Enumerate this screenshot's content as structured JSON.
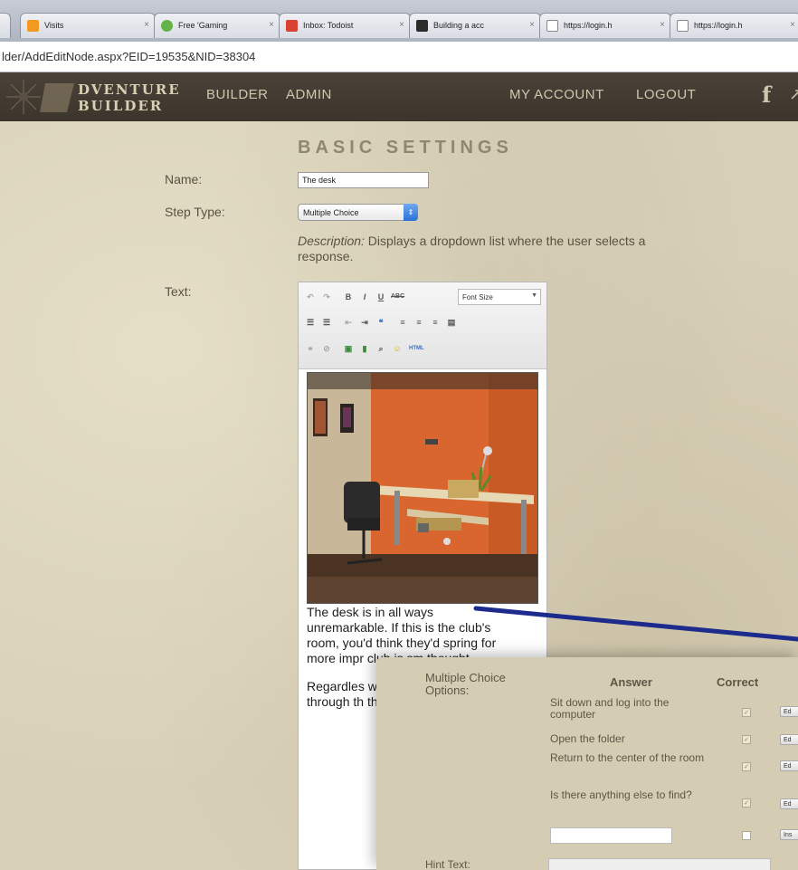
{
  "browser": {
    "tabs": [
      {
        "title": "",
        "icon_color": "#9aa0aa"
      },
      {
        "title": "Visits",
        "icon_color": "#f29a1f"
      },
      {
        "title": "Free 'Gaming",
        "icon_color": "#66b24a"
      },
      {
        "title": "Inbox: Todoist",
        "icon_color": "#d94133"
      },
      {
        "title": "Building a acc",
        "icon_color": "#2b2b2b"
      },
      {
        "title": "https://login.h",
        "icon_color": "#ffffff"
      },
      {
        "title": "https://login.h",
        "icon_color": "#ffffff"
      }
    ],
    "close_glyph": "×",
    "url": "lder/AddEditNode.aspx?EID=19535&NID=38304"
  },
  "header": {
    "logo_line1": "DVENTURE",
    "logo_line2": "BUILDER",
    "nav": [
      "BUILDER",
      "ADMIN",
      "MY ACCOUNT",
      "LOGOUT"
    ],
    "social_facebook": "f"
  },
  "form": {
    "section_title": "BASIC SETTINGS",
    "name_label": "Name:",
    "name_value": "The desk",
    "step_type_label": "Step Type:",
    "step_type_value": "Multiple Choice",
    "description_prefix": "Description:",
    "description_text": " Displays a dropdown list where the user selects a response.",
    "text_label": "Text:"
  },
  "editor": {
    "font_size_label": "Font Size",
    "toolbar_icons": [
      "undo-icon",
      "redo-icon",
      "bold-icon",
      "italic-icon",
      "underline-icon",
      "strikethrough-icon",
      "bullet-list-icon",
      "numbered-list-icon",
      "outdent-icon",
      "indent-icon",
      "blockquote-icon",
      "align-left-icon",
      "align-center-icon",
      "align-right-icon",
      "justify-icon",
      "link-icon",
      "unlink-icon",
      "image-icon",
      "media-icon",
      "find-icon",
      "emoticon-icon",
      "html-icon"
    ],
    "story_p1": "The desk is in all ways unremarkable. If this is the club's room, you'd think they'd spring for more impr club is sm thought.",
    "story_p2": "Regardles waiting for anyone we through th the desk."
  },
  "choices_panel": {
    "label": "Multiple Choice Options:",
    "col_answer": "Answer",
    "col_correct": "Correct",
    "answers": [
      {
        "text": "Sit down and log into the computer",
        "action": "Ed"
      },
      {
        "text": "Open the folder",
        "action": "Ed"
      },
      {
        "text": "Return to the center of the room",
        "action": "Ed"
      },
      {
        "text": "Is there anything else to find?",
        "action": "Ed"
      }
    ],
    "new_action": "Ins",
    "hint_label": "Hint Text:"
  },
  "colors": {
    "header_bg": "#3c352c",
    "parchment": "#d8d0b7",
    "connector": "#1c2b8c"
  }
}
